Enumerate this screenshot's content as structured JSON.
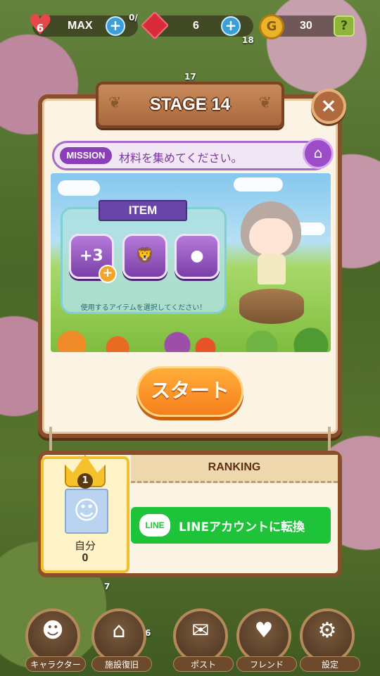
{
  "status_bar": {
    "hearts": "6",
    "hearts_max": "MAX",
    "gems": "6",
    "gold": "30",
    "gold_symbol": "G",
    "help_symbol": "?",
    "badge_counter": "0/",
    "small_counter_1": "18",
    "small_counter_2": "17"
  },
  "stage": {
    "title": "STAGE 14",
    "close_symbol": "×"
  },
  "mission": {
    "label": "MISSION",
    "text": "材料を集めてください。"
  },
  "items": {
    "banner": "ITEM",
    "list": [
      {
        "name": "plus-three-moves",
        "label": "+3"
      },
      {
        "name": "lion-item",
        "label": ""
      },
      {
        "name": "bomb-item",
        "label": ""
      }
    ],
    "add_symbol": "+",
    "hint": "使用するアイテムを選択してください！"
  },
  "start_button": "スタート",
  "ranking": {
    "title": "RANKING",
    "rank": "1",
    "player_name": "自分",
    "player_score": "0",
    "line_logo": "LINE",
    "line_button": "LINEアカウントに転換"
  },
  "bottom_nav": [
    {
      "id": "character",
      "label": "キャラクター",
      "icon": "character-icon"
    },
    {
      "id": "restore",
      "label": "施設復旧",
      "icon": "house-icon"
    },
    {
      "id": "post",
      "label": "ポスト",
      "icon": "mail-icon"
    },
    {
      "id": "friend",
      "label": "フレンド",
      "icon": "friend-icon"
    },
    {
      "id": "settings",
      "label": "設定",
      "icon": "gear-icon"
    }
  ],
  "nav_counter_1": "7",
  "nav_counter_2": "6",
  "colors": {
    "panel_border": "#8a4f2a",
    "mission_purple": "#8a3fb8",
    "start_orange": "#f6801c",
    "line_green": "#1fc33a"
  }
}
